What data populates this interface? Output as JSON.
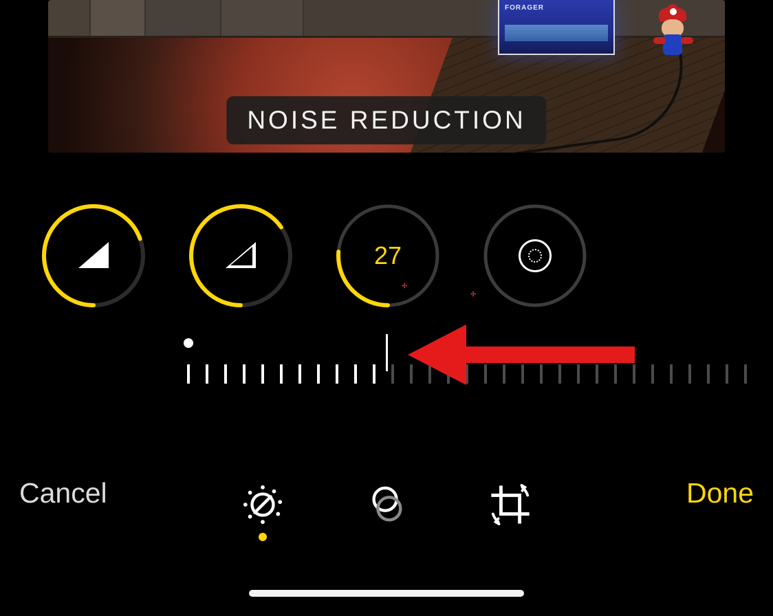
{
  "editor": {
    "current_adjustment_label": "NOISE REDUCTION",
    "current_value": "27",
    "dials": [
      {
        "name": "sharpness",
        "icon": "triangle-filled-icon",
        "progress_deg": 250,
        "display": ""
      },
      {
        "name": "definition",
        "icon": "triangle-outline-icon",
        "progress_deg": 235,
        "display": ""
      },
      {
        "name": "noise-reduction",
        "icon": "value",
        "progress_deg": 95,
        "display": "27",
        "selected": true
      },
      {
        "name": "vignette",
        "icon": "vignette-icon",
        "progress_deg": 0,
        "display": ""
      }
    ],
    "slider": {
      "zero_offset_ticks": 0,
      "value_ticks": 11,
      "total_ticks": 31
    }
  },
  "toolbar": {
    "cancel_label": "Cancel",
    "done_label": "Done",
    "tabs": [
      {
        "name": "adjust",
        "icon": "adjust-icon",
        "selected": true
      },
      {
        "name": "filters",
        "icon": "filters-icon",
        "selected": false
      },
      {
        "name": "crop",
        "icon": "crop-icon",
        "selected": false
      }
    ]
  },
  "annotation": {
    "arrow_points_to": "slider-center-mark"
  },
  "colors": {
    "accent": "#ffd60a",
    "arrow": "#e51b1b"
  }
}
